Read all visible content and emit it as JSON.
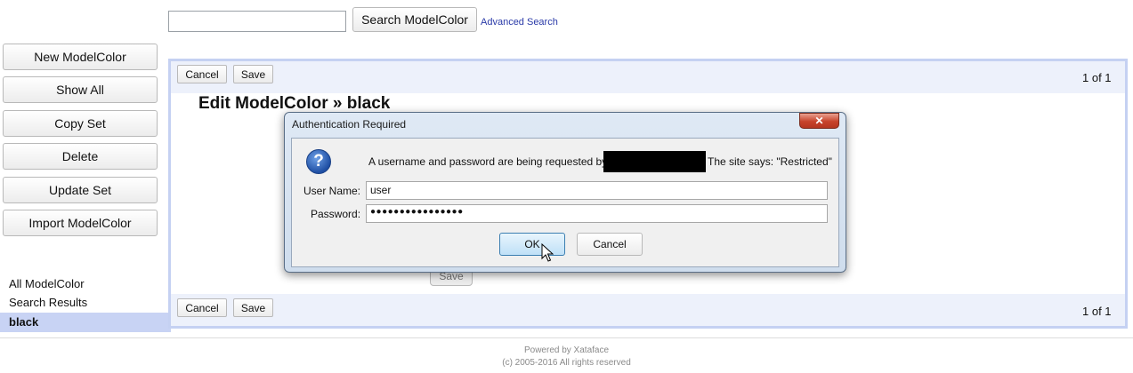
{
  "search": {
    "placeholder": "",
    "button_label": "Search ModelColor",
    "advanced_label": "Advanced Search"
  },
  "sidebar": {
    "buttons": [
      {
        "label": "New ModelColor"
      },
      {
        "label": "Show All"
      },
      {
        "label": "Copy Set"
      },
      {
        "label": "Delete"
      },
      {
        "label": "Update Set"
      },
      {
        "label": "Import ModelColor"
      }
    ],
    "nav": [
      {
        "label": "All ModelColor"
      },
      {
        "label": "Search Results"
      },
      {
        "label": "black"
      }
    ]
  },
  "main": {
    "cancel_label": "Cancel",
    "save_label": "Save",
    "pager": "1 of 1",
    "heading": "Edit ModelColor » black",
    "hidden_save_label": "Save"
  },
  "footer": {
    "powered_by": "Powered by Xataface",
    "copyright": "(c) 2005-2016 All rights reserved"
  },
  "dialog": {
    "title": "Authentication Required",
    "close_glyph": "✕",
    "help_glyph": "?",
    "message_prefix": "A username and password are being requested by",
    "message_suffix": "The site says: \"Restricted\"",
    "username_label": "User Name:",
    "username_value": "user",
    "password_label": "Password:",
    "password_value": "●●●●●●●●●●●●●●●●",
    "ok_label": "OK",
    "cancel_label": "Cancel"
  }
}
